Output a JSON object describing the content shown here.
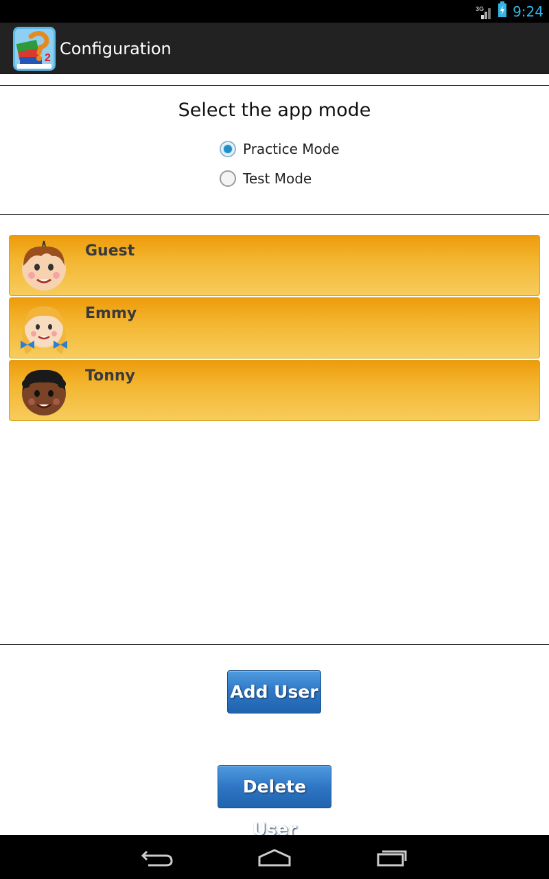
{
  "status_bar": {
    "network": "3G",
    "time": "9:24"
  },
  "action_bar": {
    "title": "Configuration",
    "app_icon": "app-logo-icon"
  },
  "mode_section": {
    "title": "Select the app mode",
    "options": [
      {
        "label": "Practice Mode",
        "checked": true
      },
      {
        "label": "Test Mode",
        "checked": false
      }
    ]
  },
  "users": [
    {
      "name": "Guest",
      "avatar": "boy-face-icon"
    },
    {
      "name": "Emmy",
      "avatar": "girl-face-icon"
    },
    {
      "name": "Tonny",
      "avatar": "dark-boy-face-icon"
    }
  ],
  "buttons": {
    "add_user": "Add User",
    "delete_user": "Delete User"
  },
  "nav_bar": {
    "icons": [
      "back-icon",
      "home-icon",
      "recent-apps-icon"
    ]
  },
  "colors": {
    "accent": "#33b5e5",
    "item_top": "#ee9b0b",
    "item_bottom": "#f7cc5d",
    "button_blue": "#2f76c4"
  }
}
